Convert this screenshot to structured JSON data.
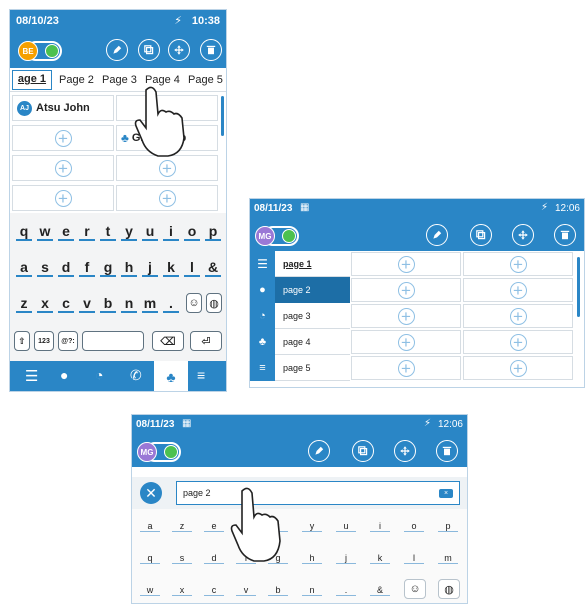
{
  "screen1": {
    "date": "08/10/23",
    "time": "10:38",
    "avatar_initials": "BE",
    "tabs": [
      "age 1",
      "Page 2",
      "Page 3",
      "Page 4",
      "Page 5"
    ],
    "contact_initials": "AJ",
    "contact_name": "Atsu John",
    "group_label": "Gro  ickup",
    "keyboard_rows": [
      [
        "q",
        "w",
        "e",
        "r",
        "t",
        "y",
        "u",
        "i",
        "o",
        "p"
      ],
      [
        "a",
        "s",
        "d",
        "f",
        "g",
        "h",
        "j",
        "k",
        "l",
        "&"
      ],
      [
        "z",
        "x",
        "c",
        "v",
        "b",
        "n",
        "m",
        "."
      ]
    ],
    "num_key": "123",
    "sym_key": "@?:",
    "icons": {
      "toolbar": [
        "pencil-icon",
        "copy-icon",
        "move-icon",
        "trash-icon"
      ],
      "bottom_nav": [
        "list-icon",
        "person-icon",
        "clock-icon",
        "phone-icon",
        "contacts-icon",
        "settings-icon"
      ]
    }
  },
  "screen2": {
    "date": "08/11/23",
    "time": "12:06",
    "avatar_initials": "MG",
    "pages": [
      "page 1",
      "page 2",
      "page 3",
      "page 4",
      "page 5"
    ]
  },
  "screen3": {
    "date": "08/11/23",
    "time": "12:06",
    "avatar_initials": "MG",
    "input_value": "page 2",
    "keyboard_rows": [
      [
        "a",
        "z",
        "e",
        "r",
        "t",
        "y",
        "u",
        "i",
        "o",
        "p"
      ],
      [
        "q",
        "s",
        "d",
        "f",
        "g",
        "h",
        "j",
        "k",
        "l",
        "m"
      ],
      [
        "w",
        "x",
        "c",
        "v",
        "b",
        "n",
        ".",
        "&"
      ]
    ]
  },
  "colors": {
    "brand_blue": "#2a86c6",
    "toggle_green": "#4cc14f",
    "avatar_orange": "#f5a000",
    "avatar_purple": "#9a78d6",
    "contact_teal": "#2a86c6",
    "selected_dark": "#1d6ea6"
  }
}
